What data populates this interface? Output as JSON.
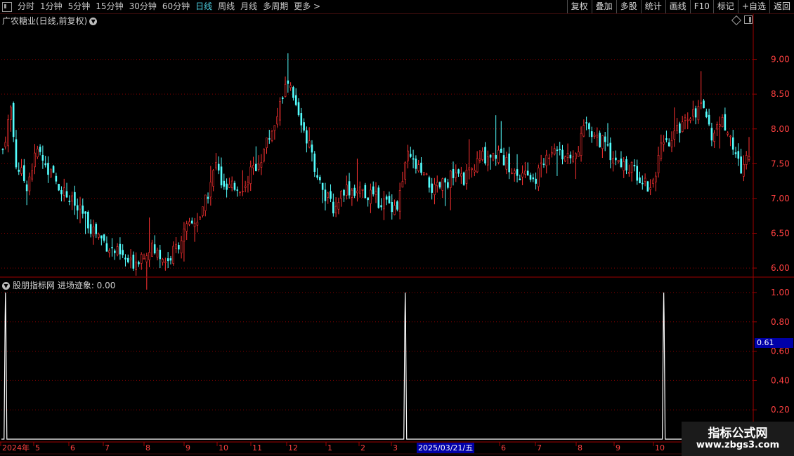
{
  "toolbar": {
    "periods": [
      "分时",
      "1分钟",
      "5分钟",
      "15分钟",
      "30分钟",
      "60分钟",
      "日线",
      "周线",
      "月线",
      "多周期",
      "更多 >"
    ],
    "active_period": "日线",
    "buttons": [
      "复权",
      "叠加",
      "多股",
      "统计",
      "画线",
      "F10",
      "标记",
      "+自选",
      "返回"
    ]
  },
  "main_panel": {
    "title": "广农糖业(日线,前复权)",
    "yticks": [
      "9.00",
      "8.50",
      "8.00",
      "7.50",
      "7.00",
      "6.50",
      "6.00"
    ]
  },
  "indicator_panel": {
    "title": "股朋指标网 进场迹象: 0.00",
    "yticks": [
      "1.00",
      "0.80",
      "0.60",
      "0.40",
      "0.20"
    ],
    "current_value_badge": "0.61"
  },
  "time_axis": {
    "labels": [
      "2024年",
      "5",
      "6",
      "7",
      "8",
      "9",
      "10",
      "11",
      "12",
      "1",
      "2",
      "3",
      "6",
      "7",
      "8",
      "9",
      "10"
    ],
    "highlighted_date": "2025/03/21/五"
  },
  "watermark": {
    "line1": "指标公式网",
    "line2": "www.zbgs3.com"
  },
  "colors": {
    "up": "#ff3232",
    "down": "#54ffff",
    "grid": "#8b0000",
    "axis": "#a00000",
    "signal": "#ffffff"
  },
  "chart_data": [
    {
      "type": "candlestick",
      "title": "广农糖业(日线,前复权)",
      "ylim": [
        5.9,
        9.5
      ],
      "close_path_points": [
        {
          "bar": 0,
          "close": 7.7
        },
        {
          "bar": 3,
          "close": 8.3
        },
        {
          "bar": 5,
          "close": 7.5
        },
        {
          "bar": 9,
          "close": 7.2
        },
        {
          "bar": 13,
          "close": 7.7
        },
        {
          "bar": 18,
          "close": 7.35
        },
        {
          "bar": 25,
          "close": 7.0
        },
        {
          "bar": 33,
          "close": 6.6
        },
        {
          "bar": 40,
          "close": 6.3
        },
        {
          "bar": 48,
          "close": 6.05
        },
        {
          "bar": 55,
          "close": 6.3
        },
        {
          "bar": 62,
          "close": 6.1
        },
        {
          "bar": 68,
          "close": 6.5
        },
        {
          "bar": 75,
          "close": 6.8
        },
        {
          "bar": 80,
          "close": 7.5
        },
        {
          "bar": 83,
          "close": 7.1
        },
        {
          "bar": 90,
          "close": 7.2
        },
        {
          "bar": 97,
          "close": 7.6
        },
        {
          "bar": 103,
          "close": 8.2
        },
        {
          "bar": 107,
          "close": 8.7
        },
        {
          "bar": 110,
          "close": 8.3
        },
        {
          "bar": 113,
          "close": 8.0
        },
        {
          "bar": 116,
          "close": 7.6
        },
        {
          "bar": 120,
          "close": 7.1
        },
        {
          "bar": 124,
          "close": 6.85
        },
        {
          "bar": 128,
          "close": 7.15
        },
        {
          "bar": 135,
          "close": 7.1
        },
        {
          "bar": 142,
          "close": 6.95
        },
        {
          "bar": 148,
          "close": 6.9
        },
        {
          "bar": 152,
          "close": 7.6
        },
        {
          "bar": 157,
          "close": 7.35
        },
        {
          "bar": 162,
          "close": 7.1
        },
        {
          "bar": 168,
          "close": 7.3
        },
        {
          "bar": 174,
          "close": 7.3
        },
        {
          "bar": 180,
          "close": 7.6
        },
        {
          "bar": 186,
          "close": 7.65
        },
        {
          "bar": 193,
          "close": 7.3
        },
        {
          "bar": 200,
          "close": 7.3
        },
        {
          "bar": 207,
          "close": 7.8
        },
        {
          "bar": 213,
          "close": 7.5
        },
        {
          "bar": 219,
          "close": 8.05
        },
        {
          "bar": 225,
          "close": 7.8
        },
        {
          "bar": 231,
          "close": 7.5
        },
        {
          "bar": 237,
          "close": 7.4
        },
        {
          "bar": 243,
          "close": 7.15
        },
        {
          "bar": 247,
          "close": 7.7
        },
        {
          "bar": 251,
          "close": 7.8
        },
        {
          "bar": 256,
          "close": 8.2
        },
        {
          "bar": 262,
          "close": 8.3
        },
        {
          "bar": 266,
          "close": 7.9
        },
        {
          "bar": 270,
          "close": 8.15
        },
        {
          "bar": 274,
          "close": 7.75
        },
        {
          "bar": 277,
          "close": 7.4
        },
        {
          "bar": 280,
          "close": 7.65
        }
      ],
      "bar_count": 281
    },
    {
      "type": "line",
      "title": "进场迹象",
      "ylim": [
        0,
        1.05
      ],
      "spikes": [
        {
          "bar": 1,
          "value": 1.0
        },
        {
          "bar": 151,
          "value": 1.0
        },
        {
          "bar": 248,
          "value": 1.0
        }
      ],
      "baseline": 0
    }
  ]
}
